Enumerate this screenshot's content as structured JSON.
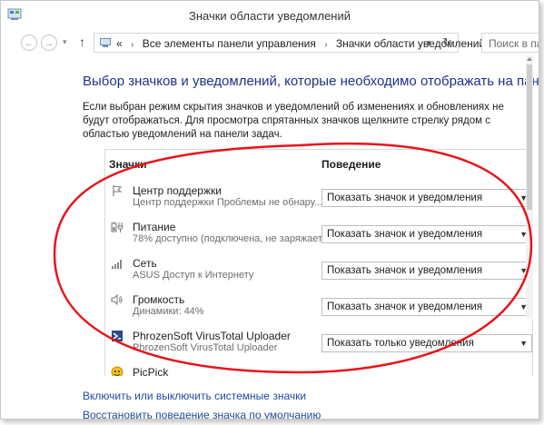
{
  "window": {
    "title": "Значки области уведомлений"
  },
  "address": {
    "crumb_1": "Все элементы панели управления",
    "crumb_2": "Значки области уведомлений",
    "separator": "›",
    "overflow": "«"
  },
  "search": {
    "placeholder": "Поиск в па"
  },
  "content": {
    "heading": "Выбор значков и уведомлений, которые необходимо отображать на панели задач",
    "description": "Если выбран режим скрытия значков и уведомлений об изменениях и обновлениях не будут отображаться. Для просмотра спрятанных значков щелкните стрелку рядом с областью уведомлений на панели задач.",
    "col_icons": "Значки",
    "col_behavior": "Поведение",
    "rows": [
      {
        "name": "Центр поддержки",
        "status": "Центр поддержки  Проблемы не обнару...",
        "behavior": "Показать значок и уведомления"
      },
      {
        "name": "Питание",
        "status": "78% доступно (подключена, не заряжает...",
        "behavior": "Показать значок и уведомления"
      },
      {
        "name": "Сеть",
        "status": "ASUS Доступ к Интернету",
        "behavior": "Показать значок и уведомления"
      },
      {
        "name": "Громкость",
        "status": "Динамики: 44%",
        "behavior": "Показать значок и уведомления"
      },
      {
        "name": "PhrozenSoft VirusTotal Uploader",
        "status": "PhrozenSoft VirusTotal Uploader",
        "behavior": "Показать только уведомления"
      },
      {
        "name": "PicPick",
        "status": "",
        "behavior": ""
      }
    ],
    "link_system_icons": "Включить или выключить системные значки",
    "link_restore": "Восстановить поведение значка по умолчанию"
  },
  "annotation": {
    "color": "#e8141b"
  }
}
